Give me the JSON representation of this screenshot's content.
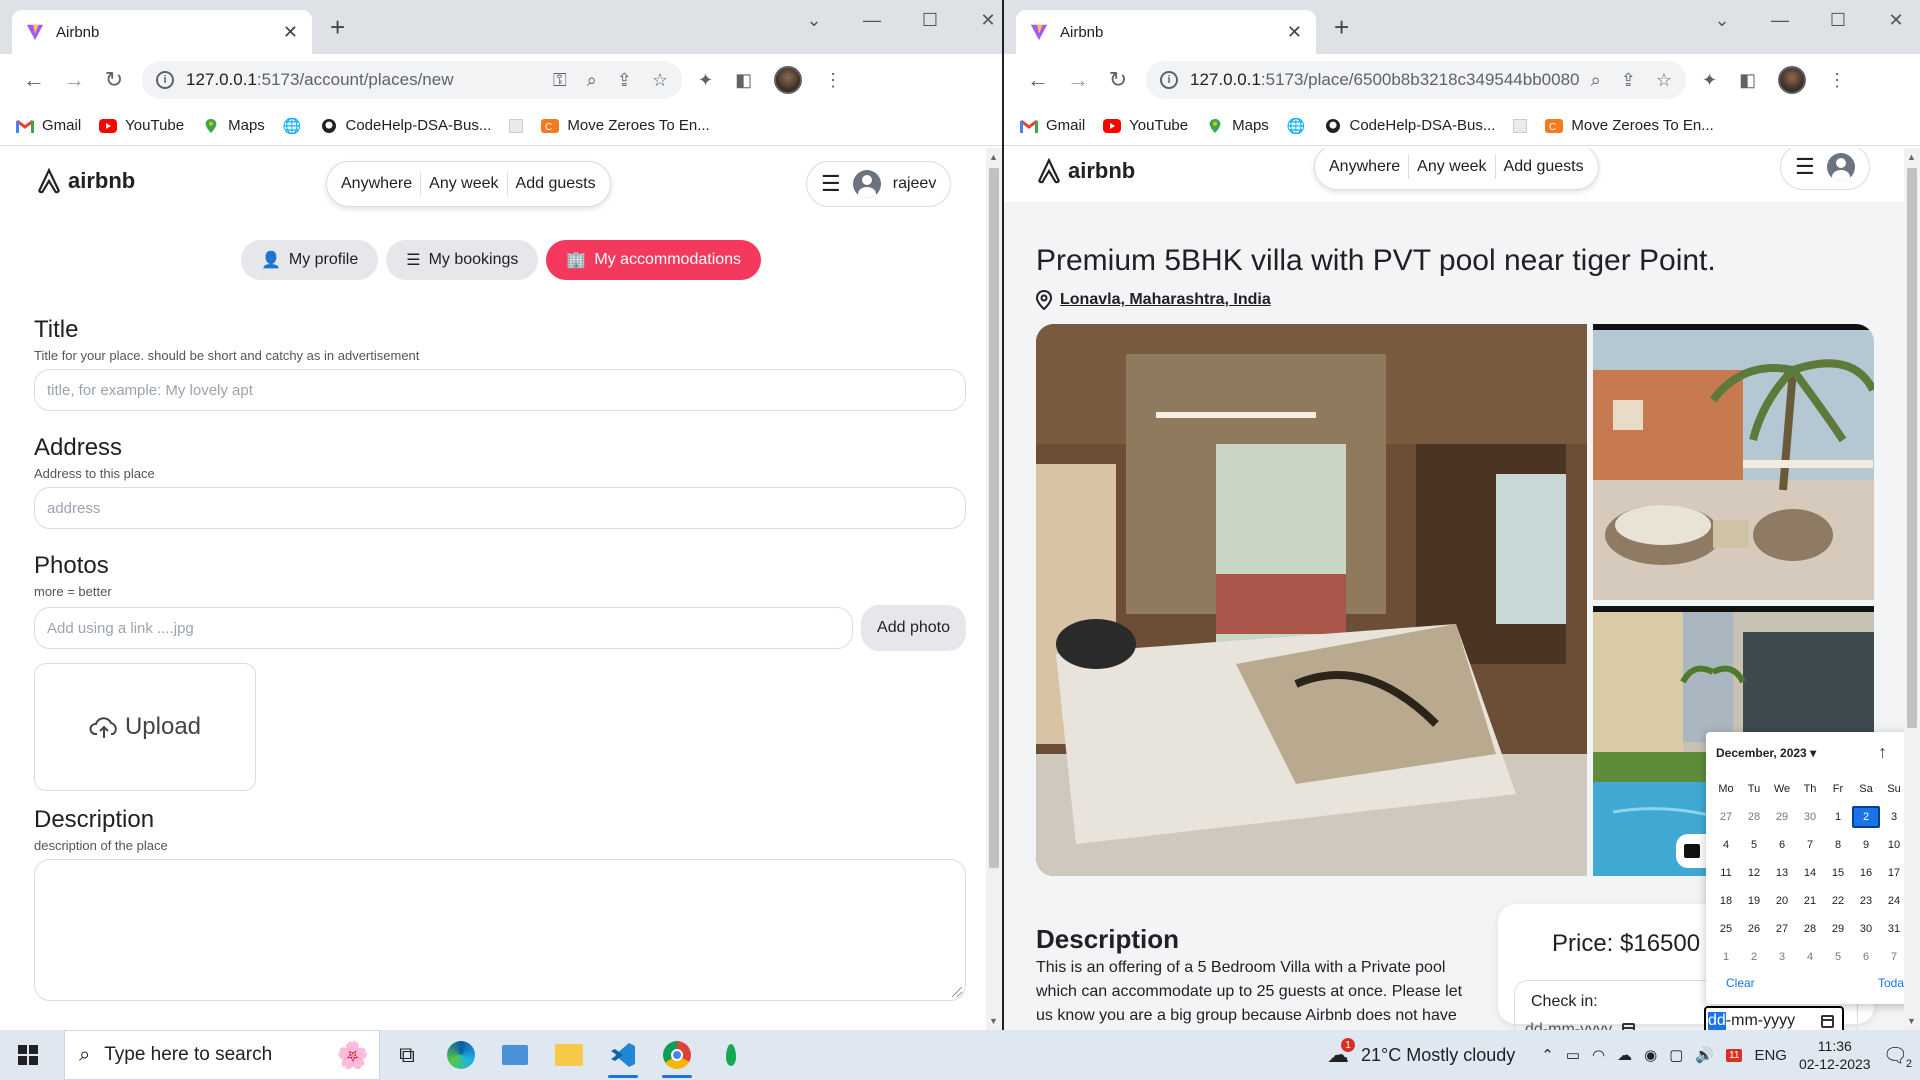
{
  "left_window": {
    "tab": {
      "title": "Airbnb"
    },
    "address": {
      "host": "127.0.0.1",
      "path": ":5173/account/places/new"
    },
    "bookmarks": [
      "Gmail",
      "YouTube",
      "Maps",
      "",
      "CodeHelp-DSA-Bus...",
      "",
      "Move Zeroes To En..."
    ],
    "brand": "airbnb",
    "search": {
      "where": "Anywhere",
      "when": "Any week",
      "guests": "Add guests"
    },
    "user": {
      "name": "rajeev"
    },
    "account_tabs": {
      "profile": "My profile",
      "bookings": "My bookings",
      "accommodations": "My accommodations"
    },
    "form": {
      "title_heading": "Title",
      "title_hint": "Title for your place. should be short and catchy as in advertisement",
      "title_placeholder": "title, for example: My lovely apt",
      "address_heading": "Address",
      "address_hint": "Address to this place",
      "address_placeholder": "address",
      "photos_heading": "Photos",
      "photos_hint": "more = better",
      "photos_placeholder": "Add using a link ....jpg",
      "add_photo": "Add photo",
      "upload": "Upload",
      "description_heading": "Description",
      "description_hint": "description of the place"
    }
  },
  "right_window": {
    "tab": {
      "title": "Airbnb"
    },
    "address": {
      "host": "127.0.0.1",
      "path": ":5173/place/6500b8b3218c349544bb0080"
    },
    "bookmarks": [
      "Gmail",
      "YouTube",
      "Maps",
      "",
      "CodeHelp-DSA-Bus...",
      "",
      "Move Zeroes To En..."
    ],
    "brand": "airbnb",
    "search": {
      "where": "Anywhere",
      "when": "Any week",
      "guests": "Add guests"
    },
    "place": {
      "title": "Premium 5BHK villa with PVT pool near tiger Point.",
      "location": "Lonavla, Maharashtra, India",
      "description_heading": "Description",
      "description": "This is an offering of a 5 Bedroom Villa with a Private pool which can accommodate up to 25 guests at once. Please let us know you are a big group because Airbnb does not have",
      "price": "Price: $16500",
      "checkin_label": "Check in:",
      "date_placeholder": "dd-mm-yyyy",
      "date_active_prefix": "dd",
      "date_active_rest": "-mm-yyyy"
    },
    "datepicker": {
      "month": "December, 2023 ▾",
      "weekdays": [
        "Mo",
        "Tu",
        "We",
        "Th",
        "Fr",
        "Sa",
        "Su"
      ],
      "days": [
        "27",
        "28",
        "29",
        "30",
        "1",
        "2",
        "3",
        "4",
        "5",
        "6",
        "7",
        "8",
        "9",
        "10",
        "11",
        "12",
        "13",
        "14",
        "15",
        "16",
        "17",
        "18",
        "19",
        "20",
        "21",
        "22",
        "23",
        "24",
        "25",
        "26",
        "27",
        "28",
        "29",
        "30",
        "31",
        "1",
        "2",
        "3",
        "4",
        "5",
        "6",
        "7"
      ],
      "selected": "2",
      "clear": "Clear",
      "today": "Today"
    }
  },
  "taskbar": {
    "search_placeholder": "Type here to search",
    "weather": "21°C  Mostly cloudy",
    "weather_badge": "1",
    "language": "ENG",
    "time": "11:36",
    "date": "02-12-2023",
    "notif_count": "2",
    "calendar_badge": "11"
  },
  "colors": {
    "accent": "#f5385d",
    "chrome_tabstrip": "#dee1e6",
    "picker_selected": "#1a73e8"
  }
}
